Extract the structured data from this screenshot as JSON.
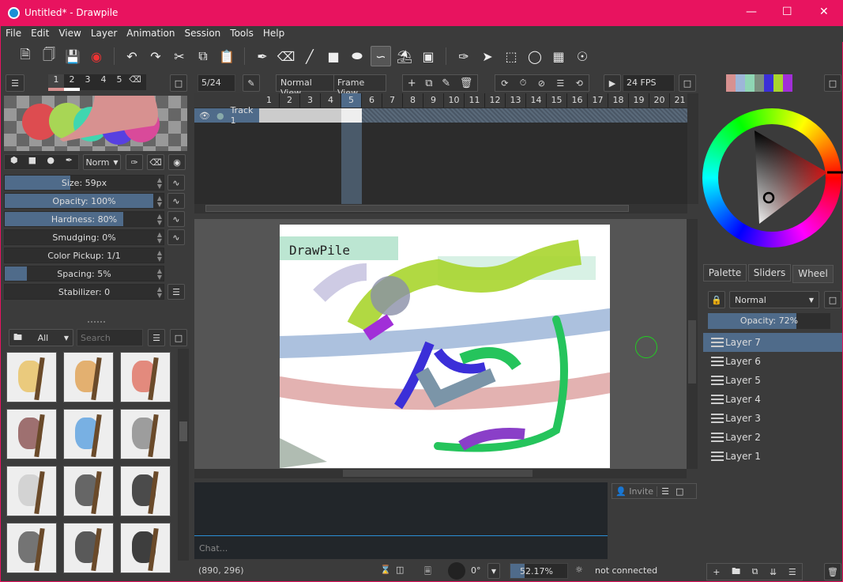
{
  "window": {
    "title": "Untitled* - Drawpile",
    "accent": "#e8135f",
    "controls": [
      "minimize",
      "maximize",
      "close"
    ]
  },
  "menu": [
    "File",
    "Edit",
    "View",
    "Layer",
    "Animation",
    "Session",
    "Tools",
    "Help"
  ],
  "toolbar": [
    "new-file",
    "open-file",
    "save",
    "record",
    "undo",
    "redo",
    "cut",
    "copy",
    "paste",
    "freehand",
    "eraser",
    "line",
    "rectangle",
    "ellipse",
    "bezier",
    "fill",
    "text",
    "color-picker",
    "select-arrow",
    "rect-select",
    "lasso-select",
    "transform",
    "inspector"
  ],
  "brush": {
    "slots": [
      "1",
      "2",
      "3",
      "4",
      "5"
    ],
    "blend_mode": "Norm",
    "sliders": [
      {
        "label": "Size: 59px",
        "value": 0.44
      },
      {
        "label": "Opacity: 100%",
        "value": 1.0
      },
      {
        "label": "Hardness: 80%",
        "value": 0.8
      },
      {
        "label": "Smudging: 0%",
        "value": 0
      },
      {
        "label": "Color Pickup: 1/1",
        "value": 0
      },
      {
        "label": "Spacing: 5%",
        "value": 0.15
      },
      {
        "label": "Stabilizer: 0",
        "value": 0
      }
    ]
  },
  "brushes": {
    "filter": "All",
    "search_placeholder": "Search"
  },
  "timeline": {
    "frame": "5/24",
    "normal_view": "Normal View",
    "frame_view": "Frame View",
    "fps": "24 FPS",
    "frames": [
      "1",
      "2",
      "3",
      "4",
      "5",
      "6",
      "7",
      "8",
      "9",
      "10",
      "11",
      "12",
      "13",
      "14",
      "15",
      "16",
      "17",
      "18",
      "19",
      "20",
      "21"
    ],
    "current_frame": 5,
    "track": "Track 1"
  },
  "canvas": {
    "text": "DrawPile"
  },
  "chat": {
    "placeholder": "Chat...",
    "invite": "Invite"
  },
  "status": {
    "coords": "(890, 296)",
    "rotation": "0°",
    "zoom": "52.17%",
    "connection": "not connected"
  },
  "colors": {
    "swatches": [
      "#d79190",
      "#9db6d8",
      "#8fd6b4",
      "#7b8f7f",
      "#3b2fd8",
      "#a8d52d",
      "#a12fd8"
    ],
    "current": "#d79190"
  },
  "color_tabs": [
    "Palette",
    "Sliders",
    "Wheel"
  ],
  "layers": {
    "blend_mode": "Normal",
    "opacity_label": "Opacity: 72%",
    "opacity": 0.72,
    "items": [
      "Layer 7",
      "Layer 6",
      "Layer 5",
      "Layer 4",
      "Layer 3",
      "Layer 2",
      "Layer 1"
    ],
    "selected": "Layer 7"
  }
}
